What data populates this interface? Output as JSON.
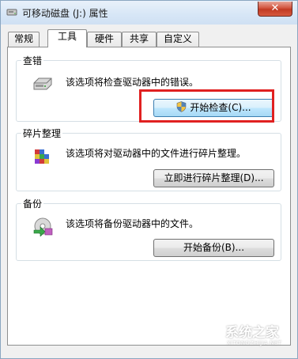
{
  "window": {
    "title": "可移动磁盘 (J:) 属性",
    "close_label": "✕"
  },
  "tabs": [
    {
      "label": "常规",
      "active": false
    },
    {
      "label": "工具",
      "active": true
    },
    {
      "label": "硬件",
      "active": false
    },
    {
      "label": "共享",
      "active": false
    },
    {
      "label": "自定义",
      "active": false
    }
  ],
  "error_check": {
    "title": "查错",
    "description": "该选项将检查驱动器中的错误。",
    "button_label": "开始检查(C)...",
    "icon": "drive-icon"
  },
  "defrag": {
    "title": "碎片整理",
    "description": "该选项将对驱动器中的文件进行碎片整理。",
    "button_label": "立即进行碎片整理(D)...",
    "icon": "defrag-icon"
  },
  "backup": {
    "title": "备份",
    "description": "该选项将备份驱动器中的文件。",
    "button_label": "开始备份(B)...",
    "icon": "backup-icon"
  },
  "watermark": {
    "text": "系统之家",
    "subtext": "XITONGZHIJIA.NET"
  },
  "colors": {
    "highlight_box": "#e02020",
    "close_button": "#c13a23"
  }
}
